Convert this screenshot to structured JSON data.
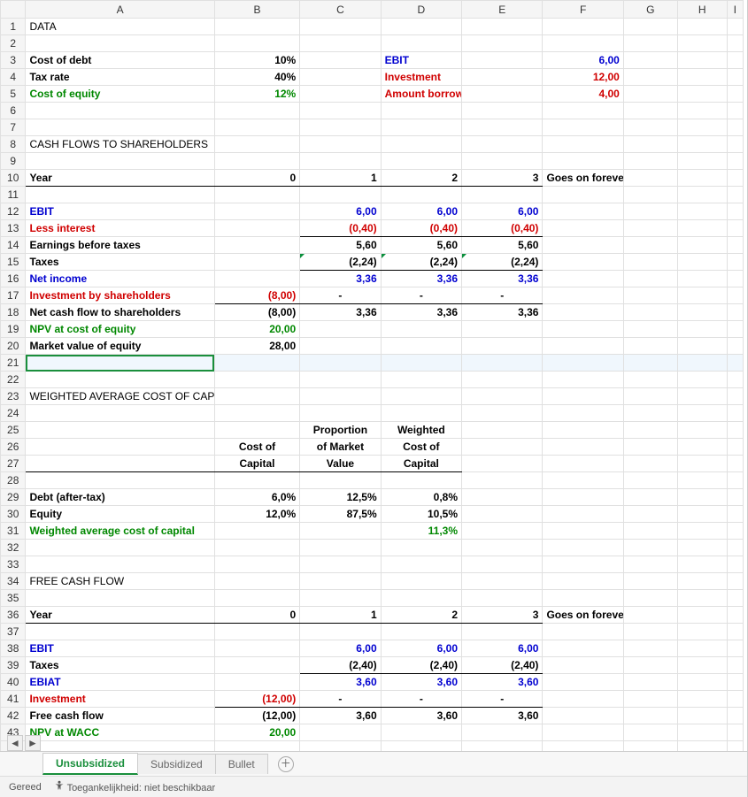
{
  "colHeaders": [
    "A",
    "B",
    "C",
    "D",
    "E",
    "F",
    "G",
    "H",
    "I"
  ],
  "rows": {
    "1": {
      "A": "DATA"
    },
    "3": {
      "A": "Cost of debt",
      "B": "10%",
      "D": "EBIT",
      "F": "6,00"
    },
    "4": {
      "A": "Tax rate",
      "B": "40%",
      "D": "Investment",
      "F": "12,00"
    },
    "5": {
      "A": "Cost of equity",
      "B": "12%",
      "D": "Amount borrowed",
      "F": "4,00"
    },
    "8": {
      "A": "CASH FLOWS TO SHAREHOLDERS"
    },
    "10": {
      "A": "Year",
      "B": "0",
      "C": "1",
      "D": "2",
      "E": "3",
      "F": "Goes on forever"
    },
    "12": {
      "A": "EBIT",
      "C": "6,00",
      "D": "6,00",
      "E": "6,00"
    },
    "13": {
      "A": "Less interest",
      "C": "(0,40)",
      "D": "(0,40)",
      "E": "(0,40)"
    },
    "14": {
      "A": "Earnings before taxes",
      "C": "5,60",
      "D": "5,60",
      "E": "5,60"
    },
    "15": {
      "A": "Taxes",
      "C": "(2,24)",
      "D": "(2,24)",
      "E": "(2,24)"
    },
    "16": {
      "A": "Net income",
      "C": "3,36",
      "D": "3,36",
      "E": "3,36"
    },
    "17": {
      "A": "Investment by shareholders",
      "B": "(8,00)",
      "C": "-",
      "D": "-",
      "E": "-"
    },
    "18": {
      "A": "Net cash flow to shareholders",
      "B": "(8,00)",
      "C": "3,36",
      "D": "3,36",
      "E": "3,36"
    },
    "19": {
      "A": "NPV at cost of equity",
      "B": "20,00"
    },
    "20": {
      "A": "Market value of equity",
      "B": "28,00"
    },
    "23": {
      "A": "WEIGHTED AVERAGE COST OF CAPITAL"
    },
    "25": {
      "C": "Proportion",
      "D": "Weighted"
    },
    "26": {
      "B": "Cost of",
      "C": "of Market",
      "D": "Cost of"
    },
    "27": {
      "B": "Capital",
      "C": "Value",
      "D": "Capital"
    },
    "29": {
      "A": "Debt (after-tax)",
      "B": "6,0%",
      "C": "12,5%",
      "D": "0,8%"
    },
    "30": {
      "A": "Equity",
      "B": "12,0%",
      "C": "87,5%",
      "D": "10,5%"
    },
    "31": {
      "A": "Weighted average cost of capital",
      "D": "11,3%"
    },
    "34": {
      "A": "FREE CASH FLOW"
    },
    "36": {
      "A": "Year",
      "B": "0",
      "C": "1",
      "D": "2",
      "E": "3",
      "F": "Goes on forever"
    },
    "38": {
      "A": "EBIT",
      "C": "6,00",
      "D": "6,00",
      "E": "6,00"
    },
    "39": {
      "A": "Taxes",
      "C": "(2,40)",
      "D": "(2,40)",
      "E": "(2,40)"
    },
    "40": {
      "A": "EBIAT",
      "C": "3,60",
      "D": "3,60",
      "E": "3,60"
    },
    "41": {
      "A": "Investment",
      "B": "(12,00)",
      "C": "-",
      "D": "-",
      "E": "-"
    },
    "42": {
      "A": "Free cash flow",
      "B": "(12,00)",
      "C": "3,60",
      "D": "3,60",
      "E": "3,60"
    },
    "43": {
      "A": "NPV at WACC",
      "B": "20,00"
    }
  },
  "tabs": [
    "Unsubsidized",
    "Subsidized",
    "Bullet"
  ],
  "activeTab": 0,
  "status": {
    "ready": "Gereed",
    "acc": "Toegankelijkheid: niet beschikbaar"
  }
}
